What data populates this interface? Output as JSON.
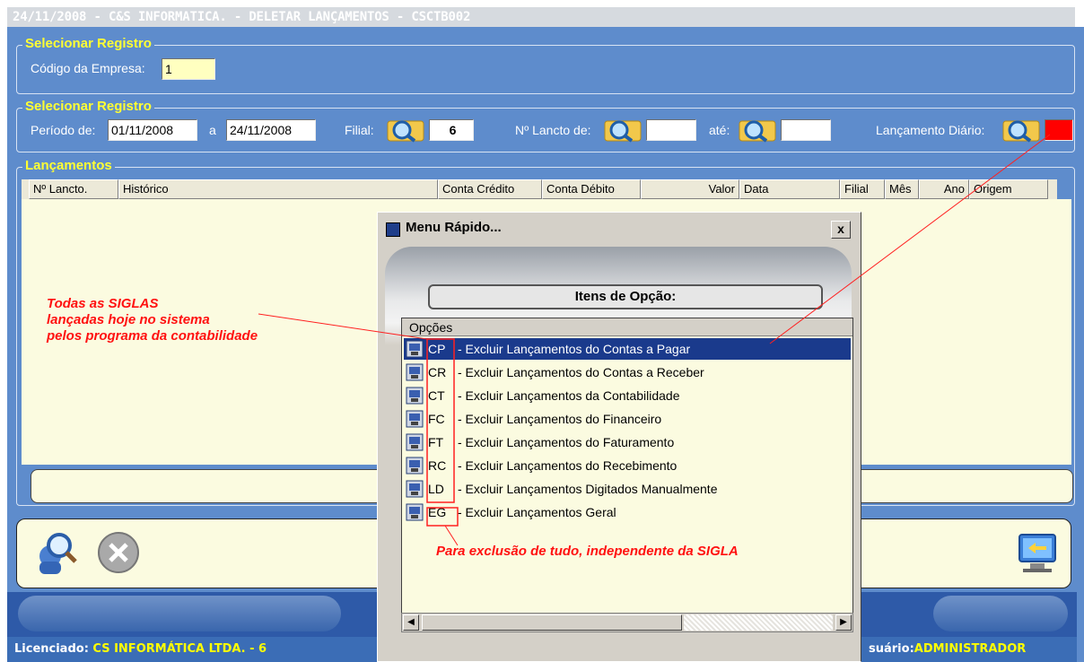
{
  "window": {
    "title": "24/11/2008 - C&S INFORMATICA. - DELETAR LANÇAMENTOS - CSCTB002"
  },
  "group1": {
    "legend": "Selecionar Registro",
    "empresa_label": "Código da Empresa:",
    "empresa_value": "1"
  },
  "group2": {
    "legend": "Selecionar Registro",
    "periodo_label": "Período de:",
    "periodo_de": "01/11/2008",
    "a_label": "a",
    "periodo_ate": "24/11/2008",
    "filial_label": "Filial:",
    "filial_value": "6",
    "lancto_de_label": "Nº Lancto de:",
    "lancto_de_value": "",
    "ate_label": "até:",
    "ate_value": "",
    "lanc_diario_label": "Lançamento Diário:"
  },
  "group3": {
    "legend": "Lançamentos",
    "columns": [
      "Nº Lancto.",
      "Histórico",
      "Conta Crédito",
      "Conta Débito",
      "Valor",
      "Data",
      "Filial",
      "Mês",
      "Ano",
      "Origem"
    ]
  },
  "dialog": {
    "title": "Menu Rápido...",
    "close": "x",
    "caption": "Itens de Opção:",
    "list_header": "Opções",
    "options": [
      {
        "code": "CP",
        "desc": "- Excluir Lançamentos do Contas a Pagar"
      },
      {
        "code": "CR",
        "desc": "- Excluir Lançamentos do Contas a Receber"
      },
      {
        "code": "CT",
        "desc": "- Excluir Lançamentos da Contabilidade"
      },
      {
        "code": "FC",
        "desc": "- Excluir Lançamentos do Financeiro"
      },
      {
        "code": "FT",
        "desc": "- Excluir Lançamentos do Faturamento"
      },
      {
        "code": "RC",
        "desc": "- Excluir Lançamentos do Recebimento"
      },
      {
        "code": "LD",
        "desc": "- Excluir Lançamentos Digitados Manualmente"
      },
      {
        "code": "EG",
        "desc": "- Excluir Lançamentos Geral"
      }
    ],
    "selected_index": 0
  },
  "annotations": {
    "note1_line1": "Todas as SIGLAS",
    "note1_line2": "lançadas hoje no sistema",
    "note1_line3": "pelos programa da contabilidade",
    "note2": "Para exclusão de tudo, independente da SIGLA"
  },
  "statusbar": {
    "licenciado_label": "Licenciado:",
    "licenciado_value": "CS INFORMÁTICA LTDA. - 6",
    "usuario_label": "suário:",
    "usuario_value": "ADMINISTRADOR"
  },
  "colors": {
    "window_bg": "#5e8ccc",
    "legend": "#ffff33",
    "selection": "#1a3a8c",
    "annotation": "#ff1010"
  }
}
